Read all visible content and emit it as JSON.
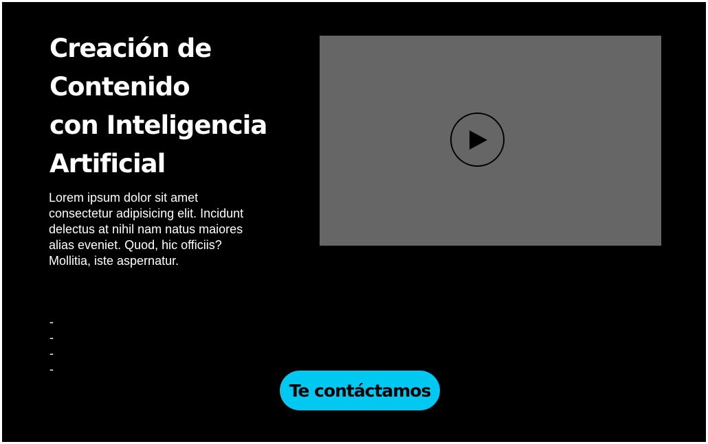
{
  "hero": {
    "title": "Creación de\nContenido\ncon Inteligencia\nArtificial",
    "description": "Lorem ipsum dolor sit amet consectetur adipisicing elit. Incidunt delectus at nihil nam natus maiores alias eveniet. Quod, hic officiis? Mollitia, iste aspernatur.",
    "list_items": [
      "-",
      "-",
      "-",
      "-"
    ]
  },
  "video": {
    "icon": "play-icon",
    "placeholder_color": "#666666"
  },
  "cta": {
    "label": "Te contáctamos",
    "color": "#00c8f0"
  },
  "colors": {
    "background": "#000000",
    "text": "#ffffff"
  }
}
